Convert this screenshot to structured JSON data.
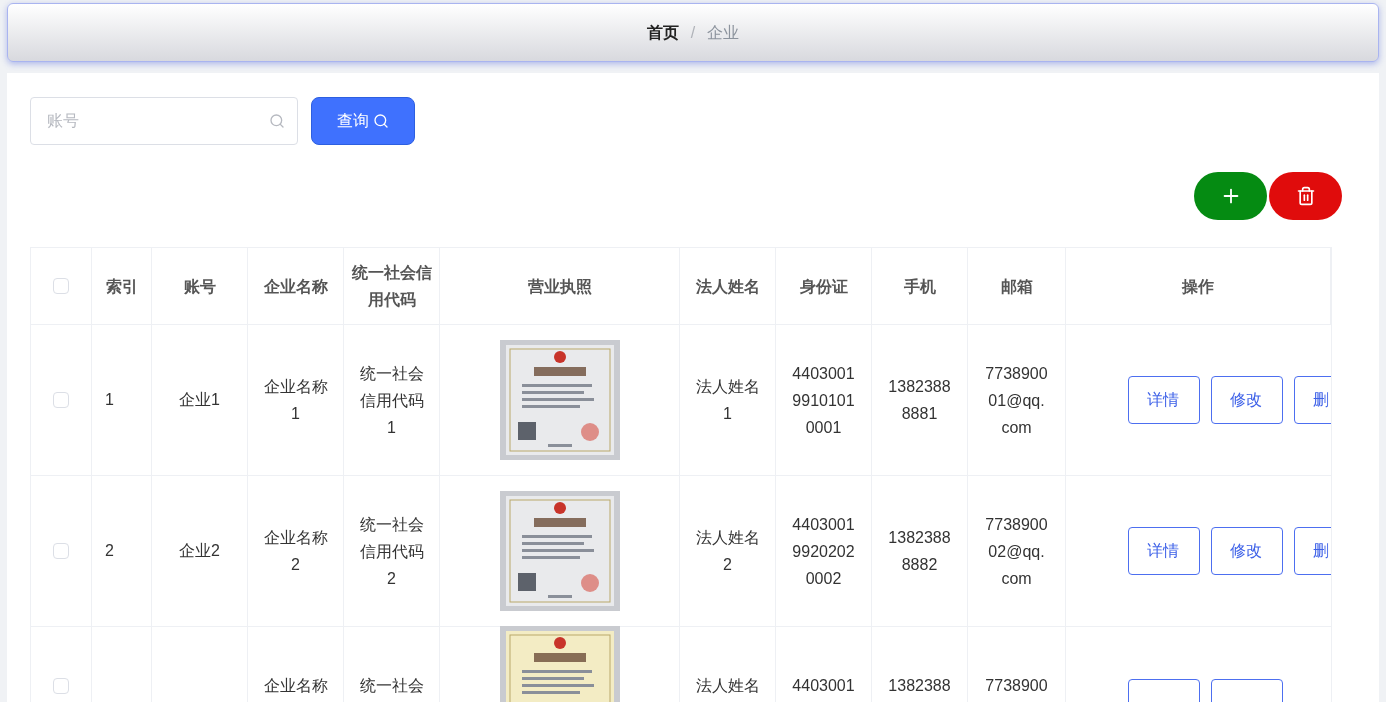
{
  "breadcrumb": [
    {
      "label": "首页",
      "current": false
    },
    {
      "label": "企业",
      "current": true
    }
  ],
  "breadcrumb_separator": "/",
  "search": {
    "placeholder": "账号"
  },
  "query_button": {
    "label": "查询"
  },
  "table": {
    "select_all_checked": false,
    "columns": [
      "索引",
      "账号",
      "企业名称",
      "统一社会信用代码",
      "营业执照",
      "法人姓名",
      "身份证",
      "手机",
      "邮箱",
      "操作"
    ],
    "rows": [
      {
        "checked": false,
        "index": "1",
        "account": "企业1",
        "company": "企业名称1",
        "credit_code": "统一社会信用代码1",
        "license": {
          "kind": "picture"
        },
        "legal_person": "法人姓名1",
        "id_card": "440300199101010001",
        "phone": "13823888881",
        "email": "773890001@qq.com",
        "actions": [
          {
            "kind": "button",
            "label": "详情"
          },
          {
            "kind": "button",
            "label": "修改"
          },
          {
            "kind": "button",
            "label": "删"
          }
        ]
      },
      {
        "checked": false,
        "index": "2",
        "account": "企业2",
        "company": "企业名称2",
        "credit_code": "统一社会信用代码2",
        "license": {
          "kind": "picture"
        },
        "legal_person": "法人姓名2",
        "id_card": "440300199202020002",
        "phone": "13823888882",
        "email": "773890002@qq.com",
        "actions": [
          {
            "kind": "button",
            "label": "详情"
          },
          {
            "kind": "button",
            "label": "修改"
          },
          {
            "kind": "button",
            "label": "删"
          }
        ]
      },
      {
        "checked": false,
        "company": "企业名称",
        "credit_code": "统一社会",
        "license": {
          "kind": "picture"
        },
        "legal_person": "法人姓名",
        "id_card": "4403001",
        "phone": "1382388",
        "email": "7738900",
        "actions": [
          {
            "kind": "button"
          },
          {
            "kind": "button"
          }
        ]
      }
    ]
  }
}
